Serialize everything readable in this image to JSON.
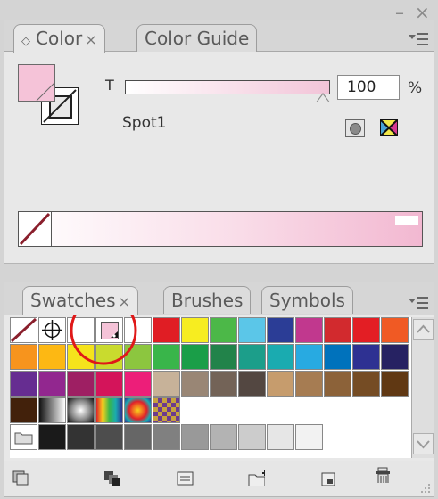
{
  "window_controls": {
    "minimize": "–",
    "close": "×"
  },
  "color_panel": {
    "tabs": [
      {
        "label": "Color",
        "close": "×",
        "active": true
      },
      {
        "label": "Color Guide",
        "active": false
      }
    ],
    "tint_label": "T",
    "tint_value": "100",
    "tint_fraction": 1.0,
    "percent_label": "%",
    "color_name": "Spot1",
    "fill_color": "#f5c3d8",
    "spectrum_end_color": "#f2b8d1"
  },
  "swatches_panel": {
    "tabs": [
      {
        "label": "Swatches",
        "close": "×",
        "active": true
      },
      {
        "label": "Brushes",
        "active": false
      },
      {
        "label": "Symbols",
        "active": false
      }
    ],
    "highlight_color": "#e01818",
    "rows": [
      [
        "none",
        "registration",
        "white",
        "spot1",
        "black",
        "#e01d24",
        "#f7ed20",
        "#4cb848",
        "#5bc6e8",
        "#2b3d96",
        "#c1388e",
        "#d22a2e",
        "#e31e24",
        "#f05a24"
      ],
      [
        "#f7941d",
        "#fdb813",
        "#f5e31c",
        "#c9db2e",
        "#8cc63f",
        "#39b54a",
        "#1a9e48",
        "#22834a",
        "#1c9e8a",
        "#1aabb0",
        "#28aae1",
        "#0072bc",
        "#2e3192",
        "#262262"
      ],
      [
        "#662d91",
        "#92278f",
        "#9e1f63",
        "#d4145a",
        "#ed1e79",
        "#c7b299",
        "#998675",
        "#736357",
        "#534741",
        "#c69c6d",
        "#a67c52",
        "#8c6239",
        "#754c24",
        "#603813"
      ],
      [
        "#42210b",
        "gradient-bw",
        "gradient-radial",
        "gradient-rainbow",
        "gradient-spectrum",
        "pattern"
      ],
      [
        "folder",
        "#1a1a1a",
        "#333333",
        "#4d4d4d",
        "#666666",
        "#808080",
        "#999999",
        "#b3b3b3",
        "#cccccc",
        "#e6e6e6",
        "#f2f2f2"
      ]
    ],
    "bottom_icons": [
      "swatch-libraries-menu-icon",
      "show-swatch-kinds-icon",
      "swatch-options-icon",
      "new-color-group-icon",
      "new-swatch-icon",
      "delete-swatch-icon"
    ]
  }
}
